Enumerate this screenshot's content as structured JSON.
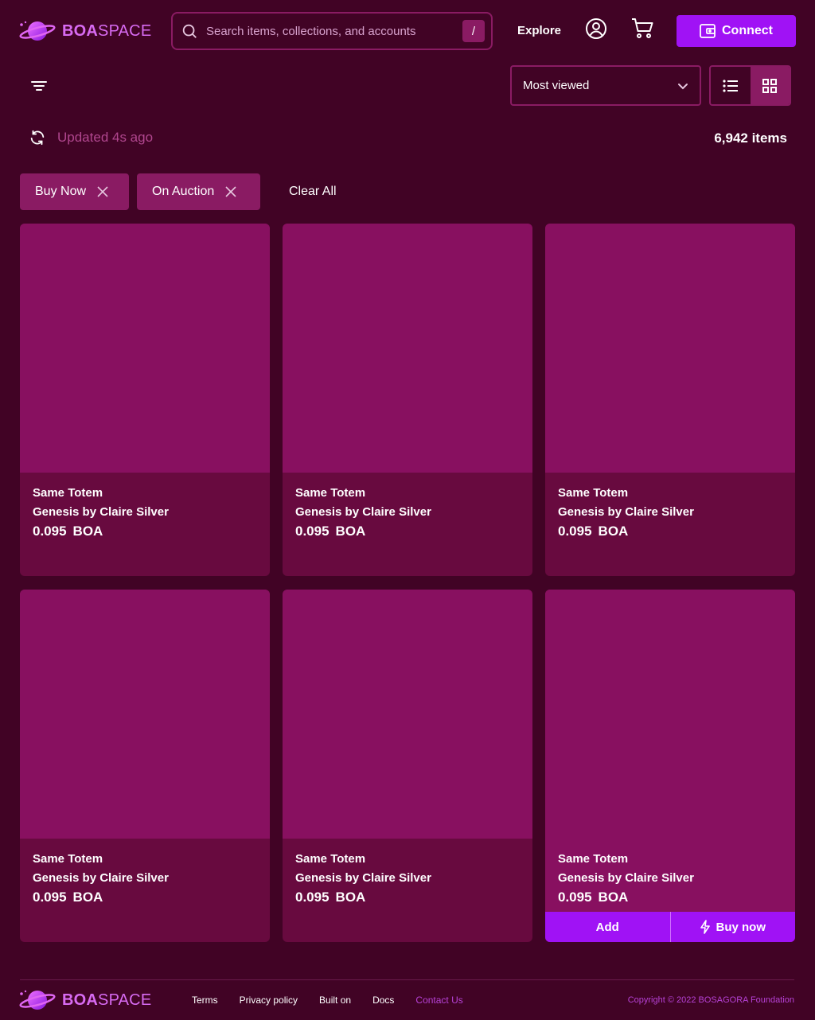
{
  "header": {
    "brand_bold": "BOA",
    "brand_light": "SPACE",
    "search_placeholder": "Search items, collections, and accounts",
    "search_shortcut": "/",
    "explore_label": "Explore",
    "connect_label": "Connect"
  },
  "toolbar": {
    "sort_value": "Most viewed",
    "updated_text": "Updated 4s ago",
    "item_count": "6,942 items"
  },
  "filters": {
    "chips": [
      "Buy Now",
      "On Auction"
    ],
    "clear_label": "Clear All"
  },
  "cards": [
    {
      "name": "Same Totem",
      "collection": "Genesis by Claire Silver",
      "price": "0.095",
      "currency": "BOA"
    },
    {
      "name": "Same Totem",
      "collection": "Genesis by Claire Silver",
      "price": "0.095",
      "currency": "BOA"
    },
    {
      "name": "Same Totem",
      "collection": "Genesis by Claire Silver",
      "price": "0.095",
      "currency": "BOA"
    },
    {
      "name": "Same Totem",
      "collection": "Genesis by Claire Silver",
      "price": "0.095",
      "currency": "BOA"
    },
    {
      "name": "Same Totem",
      "collection": "Genesis by Claire Silver",
      "price": "0.095",
      "currency": "BOA"
    },
    {
      "name": "Same Totem",
      "collection": "Genesis by Claire Silver",
      "price": "0.095",
      "currency": "BOA"
    }
  ],
  "card_actions": {
    "add_label": "Add",
    "buy_label": "Buy now"
  },
  "footer": {
    "brand_bold": "BOA",
    "brand_light": "SPACE",
    "links": [
      "Terms",
      "Privacy policy",
      "Built on",
      "Docs",
      "Contact Us"
    ],
    "copyright": "Copyright © 2022 BOSAGORA Foundation"
  },
  "colors": {
    "background": "#410325",
    "card": "#680a3f",
    "card_image": "#881060",
    "accent": "#a012f5",
    "brand": "#d86bf2"
  },
  "icons": [
    "planet-logo-icon",
    "search-icon",
    "user-icon",
    "cart-icon",
    "wallet-icon",
    "filter-icon",
    "chevron-down-icon",
    "list-view-icon",
    "grid-view-icon",
    "refresh-icon",
    "close-icon",
    "lightning-icon"
  ]
}
